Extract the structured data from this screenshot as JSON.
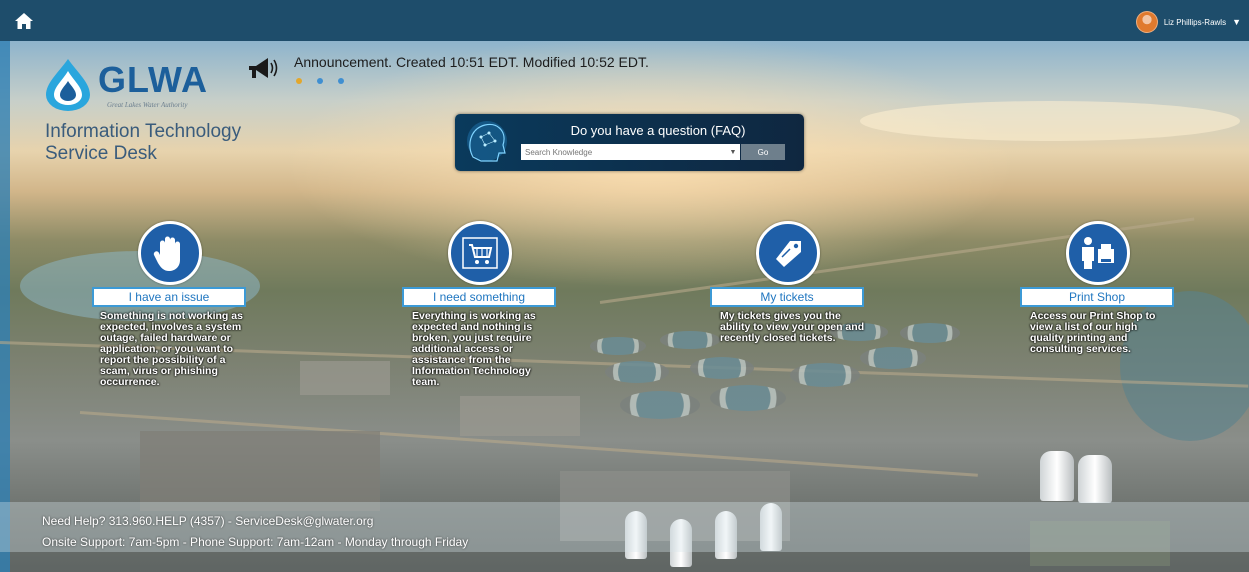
{
  "topbar": {
    "home_icon": "home-icon",
    "user_name": "Liz Phillips-Rawls",
    "caret_icon": "chevron-down-icon"
  },
  "brand": {
    "logo_text": "GLWA",
    "logo_subtitle": "Great Lakes Water Authority",
    "portal_title_line1": "Information Technology",
    "portal_title_line2": "Service Desk"
  },
  "announcement": {
    "icon": "megaphone-icon",
    "text": "Announcement. Created 10:51 EDT. Modified 10:52 EDT.",
    "dots": [
      {
        "color": "#e3a72c",
        "active": true
      },
      {
        "color": "#3f8fd1",
        "active": false
      },
      {
        "color": "#3f8fd1",
        "active": false
      }
    ]
  },
  "faq": {
    "title": "Do you have a question (FAQ)",
    "search_placeholder": "Search Knowledge",
    "dropdown_glyph": "▼",
    "go_label": "Go"
  },
  "tiles": [
    {
      "icon": "hand-stop-icon",
      "label": "I have an issue",
      "description": "Something is not working as expected, involves a system outage, failed hardware or application, or you want to report the possibility of a scam, virus or phishing occurrence."
    },
    {
      "icon": "shopping-cart-icon",
      "label": "I need something",
      "description": "Everything is working as expected and nothing is broken, you just require additional access or assistance from the Information Technology team."
    },
    {
      "icon": "tag-icon",
      "label": "My tickets",
      "description": "My tickets gives you the ability to view your open and recently closed tickets."
    },
    {
      "icon": "printer-person-icon",
      "label": "Print Shop",
      "description": "Access our Print Shop to view a list of our high quality printing and consulting services."
    }
  ],
  "footer": {
    "help_line": "Need Help? 313.960.HELP (4357) - ServiceDesk@glwater.org",
    "hours_line": "Onsite Support: 7am-5pm - Phone Support: 7am-12am - Monday through Friday"
  },
  "colors": {
    "topbar": "#1e4d6b",
    "brand_blue": "#1c5f9b",
    "tile_blue": "#1f5fa8",
    "label_border": "#3c9ad6"
  }
}
